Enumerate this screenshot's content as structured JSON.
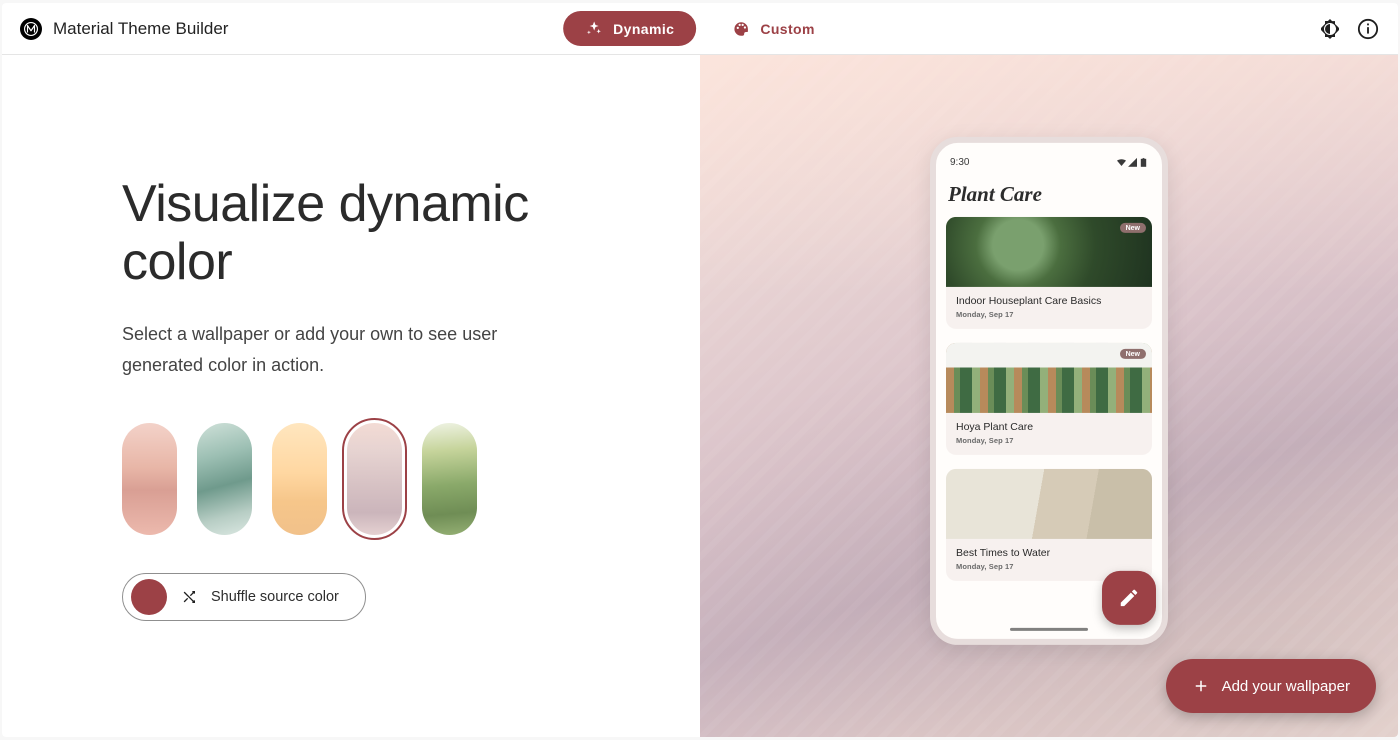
{
  "colors": {
    "accent": "#9c4146"
  },
  "brand": {
    "name": "Material Theme Builder",
    "logo_glyph": "M"
  },
  "tabs": {
    "dynamic": "Dynamic",
    "custom": "Custom",
    "active": "dynamic"
  },
  "hero": {
    "title": "Visualize dynamic color",
    "sub": "Select a wallpaper or add your own to see user generated color in action."
  },
  "wallpapers": {
    "selected_index": 3,
    "items": [
      {
        "id": "w0",
        "name": "pink-dunes"
      },
      {
        "id": "w1",
        "name": "teal-rock"
      },
      {
        "id": "w2",
        "name": "sand-dunes"
      },
      {
        "id": "w3",
        "name": "mauve-mountain"
      },
      {
        "id": "w4",
        "name": "green-hill"
      }
    ]
  },
  "shuffle": {
    "label": "Shuffle source color"
  },
  "add_wallpaper": {
    "label": "Add your wallpaper"
  },
  "phone": {
    "time": "9:30",
    "app_title": "Plant Care",
    "badge": "New",
    "cards": [
      {
        "title": "Indoor Houseplant Care Basics",
        "date": "Monday, Sep 17",
        "badge": true
      },
      {
        "title": "Hoya Plant Care",
        "date": "Monday, Sep 17",
        "badge": true
      },
      {
        "title": "Best Times to Water",
        "date": "Monday, Sep 17",
        "badge": false
      }
    ]
  }
}
